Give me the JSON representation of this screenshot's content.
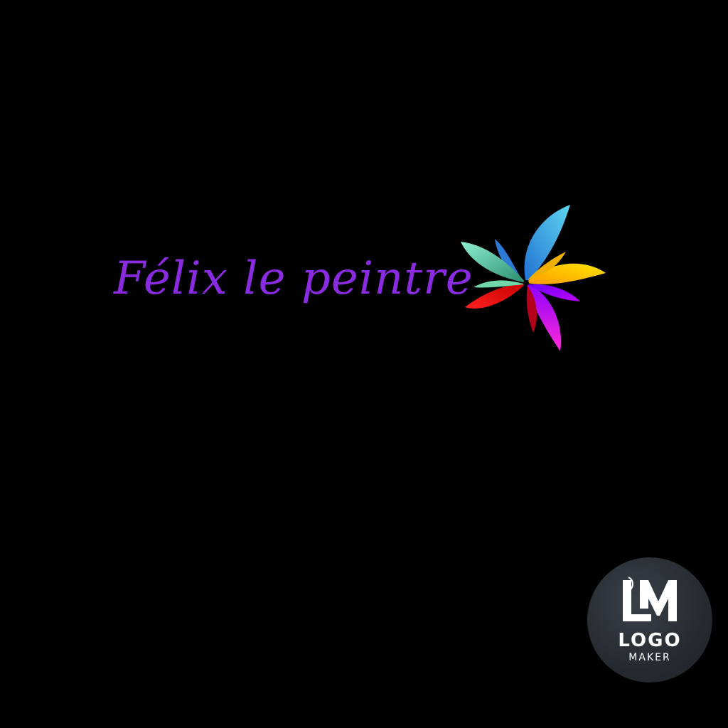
{
  "logo": {
    "title": "Félix le peintre",
    "title_color": "#8a2be2",
    "background_color": "#000000",
    "emblem": "rainbow-pinwheel-flower",
    "petal_colors": [
      "#3fc3e8",
      "#f5d100",
      "#ff9a00",
      "#ff3bd4",
      "#b000ff",
      "#ff1a1a",
      "#2a9d8f",
      "#7ee0c8"
    ]
  },
  "watermark": {
    "mark": "LM",
    "line1": "LOGO",
    "line2": "MAKER"
  }
}
